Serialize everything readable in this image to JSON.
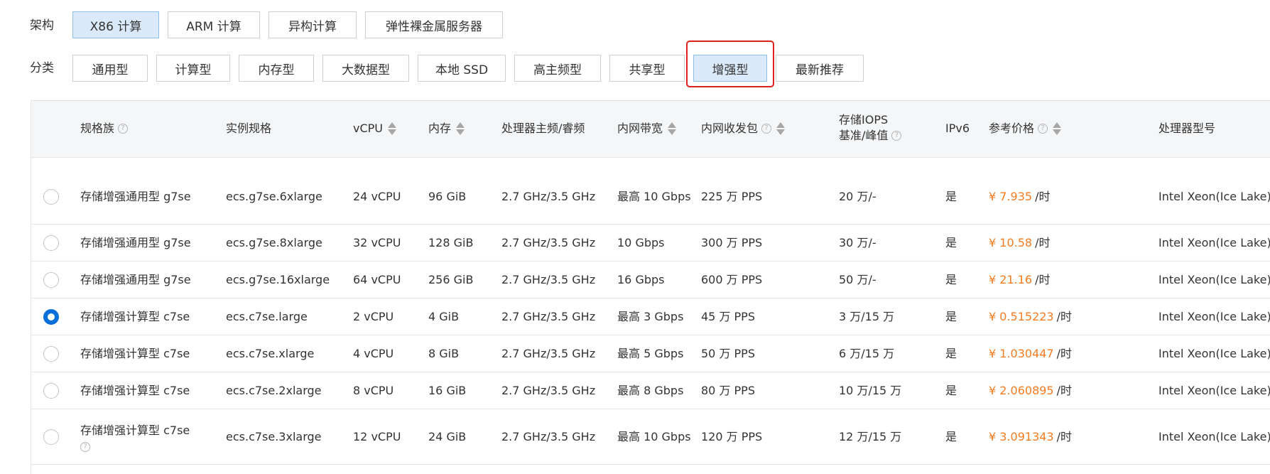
{
  "filters": {
    "arch": {
      "label": "架构",
      "options": [
        "X86 计算",
        "ARM 计算",
        "异构计算",
        "弹性裸金属服务器"
      ],
      "selected_index": 0
    },
    "category": {
      "label": "分类",
      "options": [
        "通用型",
        "计算型",
        "内存型",
        "大数据型",
        "本地 SSD",
        "高主频型",
        "共享型",
        "增强型",
        "最新推荐"
      ],
      "selected_index": 7
    }
  },
  "table": {
    "headers": {
      "family": "规格族",
      "spec": "实例规格",
      "vcpu": "vCPU",
      "memory": "内存",
      "freq": "处理器主频/睿频",
      "bandwidth": "内网带宽",
      "pps": "内网收发包",
      "iops_line1": "存储IOPS",
      "iops_line2": "基准/峰值",
      "ipv6": "IPv6",
      "price": "参考价格",
      "cpu_model": "处理器型号"
    },
    "help_icon": "question-circle-icon",
    "sort_icon": "sort-arrows-icon",
    "rows": [
      {
        "family": "存储增强通用型 g7se",
        "spec": "ecs.g7se.6xlarge",
        "vcpu": "24 vCPU",
        "memory": "96 GiB",
        "freq": "2.7 GHz/3.5 GHz",
        "bandwidth": "最高 10 Gbps",
        "pps": "225 万 PPS",
        "iops": "20 万/-",
        "ipv6": "是",
        "price": "¥ 7.935",
        "price_unit": "/时",
        "cpu_model": "Intel Xeon(Ice Lake)",
        "selected": false
      },
      {
        "family": "存储增强通用型 g7se",
        "spec": "ecs.g7se.8xlarge",
        "vcpu": "32 vCPU",
        "memory": "128 GiB",
        "freq": "2.7 GHz/3.5 GHz",
        "bandwidth": "10 Gbps",
        "pps": "300 万 PPS",
        "iops": "30 万/-",
        "ipv6": "是",
        "price": "¥ 10.58",
        "price_unit": "/时",
        "cpu_model": "Intel Xeon(Ice Lake)",
        "selected": false
      },
      {
        "family": "存储增强通用型 g7se",
        "spec": "ecs.g7se.16xlarge",
        "vcpu": "64 vCPU",
        "memory": "256 GiB",
        "freq": "2.7 GHz/3.5 GHz",
        "bandwidth": "16 Gbps",
        "pps": "600 万 PPS",
        "iops": "50 万/-",
        "ipv6": "是",
        "price": "¥ 21.16",
        "price_unit": "/时",
        "cpu_model": "Intel Xeon(Ice Lake)",
        "selected": false
      },
      {
        "family": "存储增强计算型 c7se",
        "spec": "ecs.c7se.large",
        "vcpu": "2 vCPU",
        "memory": "4 GiB",
        "freq": "2.7 GHz/3.5 GHz",
        "bandwidth": "最高 3 Gbps",
        "pps": "45 万 PPS",
        "iops": "3 万/15 万",
        "ipv6": "是",
        "price": "¥ 0.515223",
        "price_unit": "/时",
        "cpu_model": "Intel Xeon(Ice Lake)",
        "selected": true
      },
      {
        "family": "存储增强计算型 c7se",
        "spec": "ecs.c7se.xlarge",
        "vcpu": "4 vCPU",
        "memory": "8 GiB",
        "freq": "2.7 GHz/3.5 GHz",
        "bandwidth": "最高 5 Gbps",
        "pps": "50 万 PPS",
        "iops": "6 万/15 万",
        "ipv6": "是",
        "price": "¥ 1.030447",
        "price_unit": "/时",
        "cpu_model": "Intel Xeon(Ice Lake)",
        "selected": false
      },
      {
        "family": "存储增强计算型 c7se",
        "spec": "ecs.c7se.2xlarge",
        "vcpu": "8 vCPU",
        "memory": "16 GiB",
        "freq": "2.7 GHz/3.5 GHz",
        "bandwidth": "最高 8 Gbps",
        "pps": "80 万 PPS",
        "iops": "10 万/15 万",
        "ipv6": "是",
        "price": "¥ 2.060895",
        "price_unit": "/时",
        "cpu_model": "Intel Xeon(Ice Lake)",
        "selected": false
      },
      {
        "family": "存储增强计算型 c7se",
        "spec": "ecs.c7se.3xlarge",
        "vcpu": "12 vCPU",
        "memory": "24 GiB",
        "freq": "2.7 GHz/3.5 GHz",
        "bandwidth": "最高 10 Gbps",
        "pps": "120 万 PPS",
        "iops": "12 万/15 万",
        "ipv6": "是",
        "price": "¥ 3.091343",
        "price_unit": "/时",
        "cpu_model": "Intel Xeon(Ice Lake)",
        "selected": false
      }
    ]
  }
}
